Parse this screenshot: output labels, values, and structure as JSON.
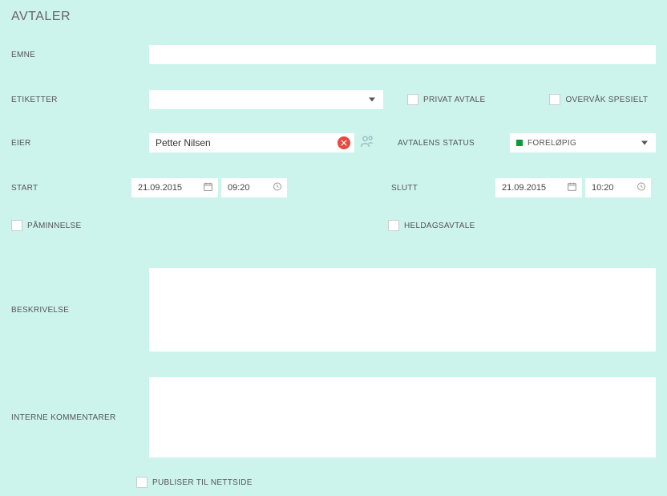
{
  "title": "AVTALER",
  "labels": {
    "emne": "EMNE",
    "etiketter": "ETIKETTER",
    "eier": "EIER",
    "start": "START",
    "slutt": "SLUTT",
    "beskrivelse": "BESKRIVELSE",
    "interne": "INTERNE KOMMENTARER",
    "avtalensStatus": "AVTALENS STATUS"
  },
  "checkboxes": {
    "privat": "PRIVAT AVTALE",
    "overvak": "OVERVÅK SPESIELT",
    "paminnelse": "PÅMINNELSE",
    "heldags": "HELDAGSAVTALE",
    "publiser": "PUBLISER TIL NETTSIDE"
  },
  "owner": "Petter Nilsen",
  "status": "FORELØPIG",
  "start": {
    "date": "21.09.2015",
    "time": "09:20"
  },
  "slutt": {
    "date": "21.09.2015",
    "time": "10:20"
  }
}
